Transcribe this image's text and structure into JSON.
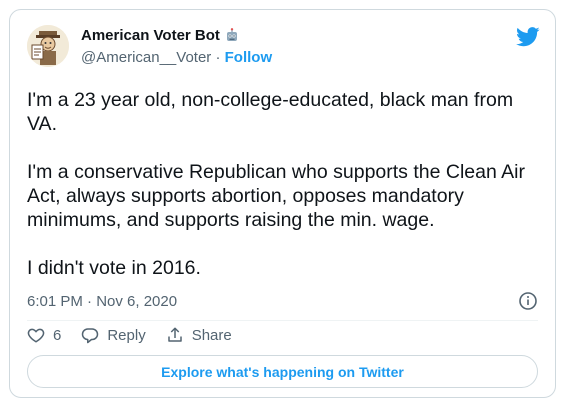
{
  "author": {
    "display_name": "American Voter Bot",
    "handle": "@American__Voter",
    "separator": "·",
    "follow_label": "Follow"
  },
  "tweet": {
    "paragraphs": [
      "I'm a 23 year old, non-college-educated, black man from VA.",
      "I'm a conservative Republican who supports the Clean Air Act, always supports abortion, opposes mandatory minimums, and supports raising the min. wage.",
      "I didn't vote in 2016."
    ],
    "timestamp": "6:01 PM · Nov 6, 2020"
  },
  "actions": {
    "like_count": "6",
    "reply_label": "Reply",
    "share_label": "Share"
  },
  "explore_label": "Explore what's happening on Twitter",
  "icons": {
    "robot": "robot-emoji",
    "twitter": "twitter-bird-icon",
    "info": "info-icon",
    "like": "heart-icon",
    "reply": "reply-icon",
    "share": "share-icon"
  },
  "colors": {
    "accent": "#1d9bf0",
    "secondary_text": "#536471",
    "border": "#cfd9de"
  }
}
